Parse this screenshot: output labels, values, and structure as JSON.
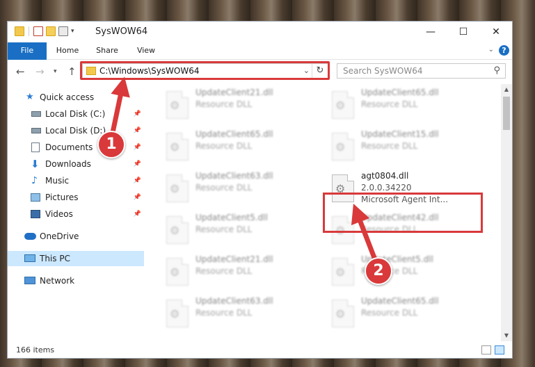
{
  "window": {
    "title": "SysWOW64"
  },
  "window_controls": {
    "minimize": "—",
    "maximize": "☐",
    "close": "✕"
  },
  "ribbon": {
    "tabs": [
      "File",
      "Home",
      "Share",
      "View"
    ],
    "help": "?"
  },
  "address": {
    "path": "C:\\Windows\\SysWOW64",
    "refresh": "↻"
  },
  "search": {
    "placeholder": "Search SysWOW64"
  },
  "sidebar": {
    "items": [
      {
        "label": "Quick access"
      },
      {
        "label": "Local Disk (C:)"
      },
      {
        "label": "Local Disk (D:)"
      },
      {
        "label": "Documents"
      },
      {
        "label": "Downloads"
      },
      {
        "label": "Music"
      },
      {
        "label": "Pictures"
      },
      {
        "label": "Videos"
      },
      {
        "label": "OneDrive"
      },
      {
        "label": "This PC"
      },
      {
        "label": "Network"
      }
    ]
  },
  "files": {
    "left": [
      {
        "name": "UpdateClient21.dll",
        "desc": "Resource DLL"
      },
      {
        "name": "UpdateClient65.dll",
        "desc": "Resource DLL"
      },
      {
        "name": "UpdateClient63.dll",
        "desc": "Resource DLL"
      },
      {
        "name": "UpdateClient5.dll",
        "desc": "Resource DLL"
      },
      {
        "name": "UpdateClient21.dll",
        "desc": "Resource DLL"
      },
      {
        "name": "UpdateClient63.dll",
        "desc": "Resource DLL"
      }
    ],
    "right": [
      {
        "name": "UpdateClient65.dll",
        "desc": "Resource DLL"
      },
      {
        "name": "UpdateClient15.dll",
        "desc": "Resource DLL"
      },
      {
        "name": "UpdateClient42.dll",
        "desc": "Resource DLL"
      },
      {
        "name": "UpdateClient5.dll",
        "desc": "Resource DLL"
      },
      {
        "name": "UpdateClient65.dll",
        "desc": "Resource DLL"
      }
    ],
    "selected": {
      "name": "agt0804.dll",
      "version": "2.0.0.34220",
      "desc": "Microsoft Agent Int..."
    }
  },
  "status": {
    "count": "166 items"
  },
  "annotations": {
    "step1": "1",
    "step2": "2",
    "color": "#d9393a"
  }
}
